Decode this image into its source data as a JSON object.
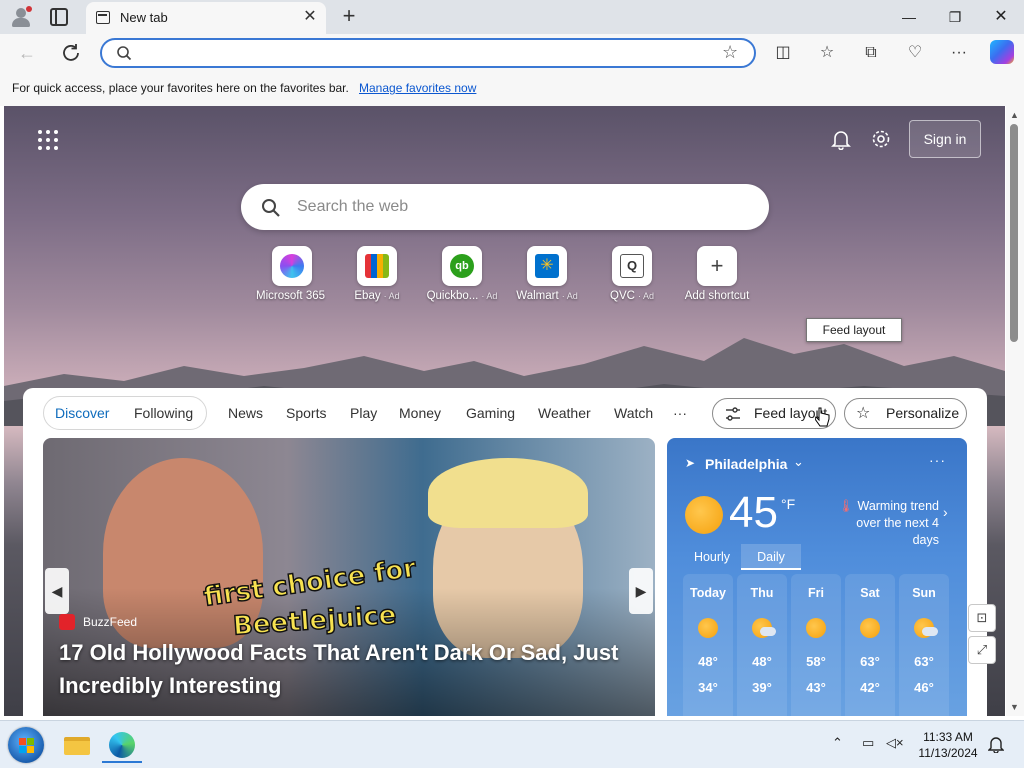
{
  "browser": {
    "tab_title": "New tab",
    "address_value": "",
    "favorites_bar": {
      "message": "For quick access, place your favorites here on the favorites bar.",
      "link": "Manage favorites now"
    }
  },
  "page": {
    "search_placeholder": "Search the web",
    "sign_in": "Sign in",
    "shortcuts": [
      {
        "label": "Microsoft 365",
        "ad": ""
      },
      {
        "label": "Ebay",
        "ad": "· Ad"
      },
      {
        "label": "Quickbo...",
        "ad": "· Ad"
      },
      {
        "label": "Walmart",
        "ad": "· Ad"
      },
      {
        "label": "QVC",
        "ad": "· Ad"
      },
      {
        "label": "Add shortcut",
        "ad": ""
      }
    ],
    "nav": {
      "pill": [
        "Discover",
        "Following"
      ],
      "tabs": [
        "News",
        "Sports",
        "Play",
        "Money",
        "Gaming",
        "Weather",
        "Watch"
      ],
      "more": "···",
      "feed_layout": "Feed layout",
      "personalize": "Personalize",
      "tooltip": "Feed layout"
    },
    "hero": {
      "source": "BuzzFeed",
      "headline": "17 Old Hollywood Facts That Aren't Dark Or Sad, Just Incredibly Interesting",
      "image_caption_line1": "first choice for",
      "image_caption_line2": "Beetlejuice"
    },
    "weather": {
      "location": "Philadelphia",
      "temp": "45",
      "unit": "°F",
      "trend_title": "Warming trend",
      "trend_sub": "over the next 4 days",
      "tabs": [
        "Hourly",
        "Daily"
      ],
      "days": [
        {
          "name": "Today",
          "hi": "48°",
          "lo": "34°",
          "icon": "sunny"
        },
        {
          "name": "Thu",
          "hi": "48°",
          "lo": "39°",
          "icon": "partly-cloudy"
        },
        {
          "name": "Fri",
          "hi": "58°",
          "lo": "43°",
          "icon": "sunny"
        },
        {
          "name": "Sat",
          "hi": "63°",
          "lo": "42°",
          "icon": "sunny"
        },
        {
          "name": "Sun",
          "hi": "63°",
          "lo": "46°",
          "icon": "partly-cloudy"
        }
      ]
    }
  },
  "taskbar": {
    "time": "11:33 AM",
    "date": "11/13/2024"
  },
  "colors": {
    "accent": "#0f6cbd",
    "omnibox_border": "#3a78d4",
    "weather_bg": "#4f8ddb"
  }
}
